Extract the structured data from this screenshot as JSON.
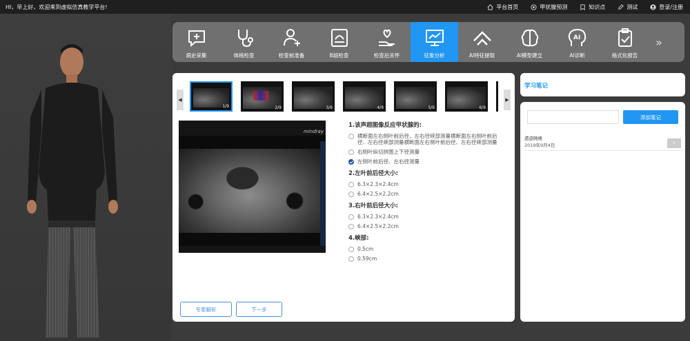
{
  "topbar": {
    "greeting": "HI，早上好，欢迎来到虚拟仿真教学平台!",
    "nav": [
      {
        "label": "平台首页",
        "icon": "home-icon"
      },
      {
        "label": "甲状腺预测",
        "icon": "target-icon"
      },
      {
        "label": "知识点",
        "icon": "bookmark-icon"
      },
      {
        "label": "测试",
        "icon": "edit-icon"
      },
      {
        "label": "登录/注册",
        "icon": "user-icon"
      }
    ]
  },
  "steps": [
    {
      "label": "病史采集",
      "icon": "chat-plus-icon",
      "active": false
    },
    {
      "label": "体格检查",
      "icon": "stethoscope-icon",
      "active": false
    },
    {
      "label": "检查前准备",
      "icon": "clipboard-user-icon",
      "active": false
    },
    {
      "label": "B超检查",
      "icon": "ultrasound-icon",
      "active": false
    },
    {
      "label": "检查后关怀",
      "icon": "hand-heart-icon",
      "active": false
    },
    {
      "label": "征象分析",
      "icon": "monitor-chart-icon",
      "active": true
    },
    {
      "label": "AI特征提取",
      "icon": "layers-icon",
      "active": false
    },
    {
      "label": "AI模型建立",
      "icon": "brain-icon",
      "active": false
    },
    {
      "label": "AI诊断",
      "icon": "ai-head-icon",
      "active": false
    },
    {
      "label": "格式化报告",
      "icon": "clipboard-check-icon",
      "active": false
    }
  ],
  "thumbnails": [
    "1/9",
    "2/9",
    "3/9",
    "4/9",
    "5/9",
    "6/9"
  ],
  "questions": [
    {
      "title": "1.该声超图像反应甲状腺的:",
      "options": [
        {
          "text": "横断面左右侧叶前后径、左右径峡部测量横断面左右侧叶前后径、左右径峡部测量横断面左右侧叶前后径、左右径峡部测量",
          "checked": false
        },
        {
          "text": "右侧叶纵切拼图上下径测量",
          "checked": false
        },
        {
          "text": "左侧叶前后径、左右径测量",
          "checked": true
        }
      ]
    },
    {
      "title": "2.左叶前后径大小:",
      "options": [
        {
          "text": "6.3×2.3×2.4cm",
          "checked": false
        },
        {
          "text": "6.4×2.5×2.2cm",
          "checked": false
        }
      ]
    },
    {
      "title": "3.右叶前后径大小:",
      "options": [
        {
          "text": "6.3×2.3×2.4cm",
          "checked": false
        },
        {
          "text": "6.4×2.5×2.2cm",
          "checked": false
        }
      ]
    },
    {
      "title": "4.峡部:",
      "options": [
        {
          "text": "0.5cm",
          "checked": false
        },
        {
          "text": "0.59cm",
          "checked": false
        }
      ]
    }
  ],
  "buttons": {
    "expert": "专家解析",
    "next": "下一步"
  },
  "ultrasound": {
    "brand": "mindray"
  },
  "notes": {
    "title": "学习笔记",
    "add_label": "添加笔记",
    "input_value": "",
    "items": [
      {
        "text": "遗迹网络",
        "date": "2019年9月4日"
      }
    ]
  },
  "colors": {
    "accent": "#2196f3",
    "stepbar": "#707070",
    "topbar": "#1f1f1f"
  }
}
